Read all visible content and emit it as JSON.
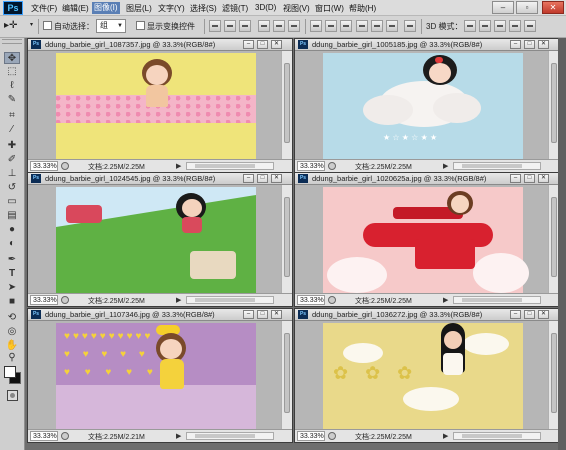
{
  "app": {
    "logo": "Ps"
  },
  "menubar": {
    "items": [
      "文件(F)",
      "编辑(E)",
      "图像(I)",
      "图层(L)",
      "文字(Y)",
      "选择(S)",
      "滤镜(T)",
      "3D(D)",
      "视图(V)",
      "窗口(W)",
      "帮助(H)"
    ],
    "active_item": "图像(I)"
  },
  "options_bar": {
    "auto_select_label": "自动选择：",
    "group_value": "组",
    "show_transform_label": "显示变换控件",
    "mode_3d_label": "3D 模式："
  },
  "documents": [
    {
      "title": "ddung_barbie_girl_1087357.jpg @ 33.3%(RGB/8#)",
      "zoom": "33.33%",
      "doc_size": "文档:2.25M/2.25M"
    },
    {
      "title": "ddung_barbie_girl_1005185.jpg @ 33.3%(RGB/8#)",
      "zoom": "33.33%",
      "doc_size": "文档:2.25M/2.25M"
    },
    {
      "title": "ddung_barbie_girl_1024545.jpg @ 33.3%(RGB/8#)",
      "zoom": "33.33%",
      "doc_size": "文档:2.25M/2.25M"
    },
    {
      "title": "ddung_barbie_girl_1020625a.jpg @ 33.3%(RGB/8#)",
      "zoom": "33.33%",
      "doc_size": "文档:2.25M/2.25M"
    },
    {
      "title": "ddung_barbie_girl_1107346.jpg @ 33.3%(RGB/8#)",
      "zoom": "33.33%",
      "doc_size": "文档:2.25M/2.21M"
    },
    {
      "title": "ddung_barbie_girl_1036272.jpg @ 33.3%(RGB/8#)",
      "zoom": "33.33%",
      "doc_size": "文档:2.25M/2.25M"
    }
  ],
  "colors": {
    "foreground": "#ffffff",
    "background": "#111111",
    "active_menu": "#5a7fb5"
  },
  "tools": [
    "move-icon",
    "marquee-icon",
    "lasso-icon",
    "quick-select-icon",
    "crop-icon",
    "eyedropper-icon",
    "healing-icon",
    "brush-icon",
    "stamp-icon",
    "history-brush-icon",
    "eraser-icon",
    "gradient-icon",
    "blur-icon",
    "dodge-icon",
    "pen-icon",
    "type-icon",
    "path-select-icon",
    "shape-icon",
    "3d-rotate-icon",
    "3d-orbit-icon",
    "hand-icon",
    "zoom-icon"
  ]
}
